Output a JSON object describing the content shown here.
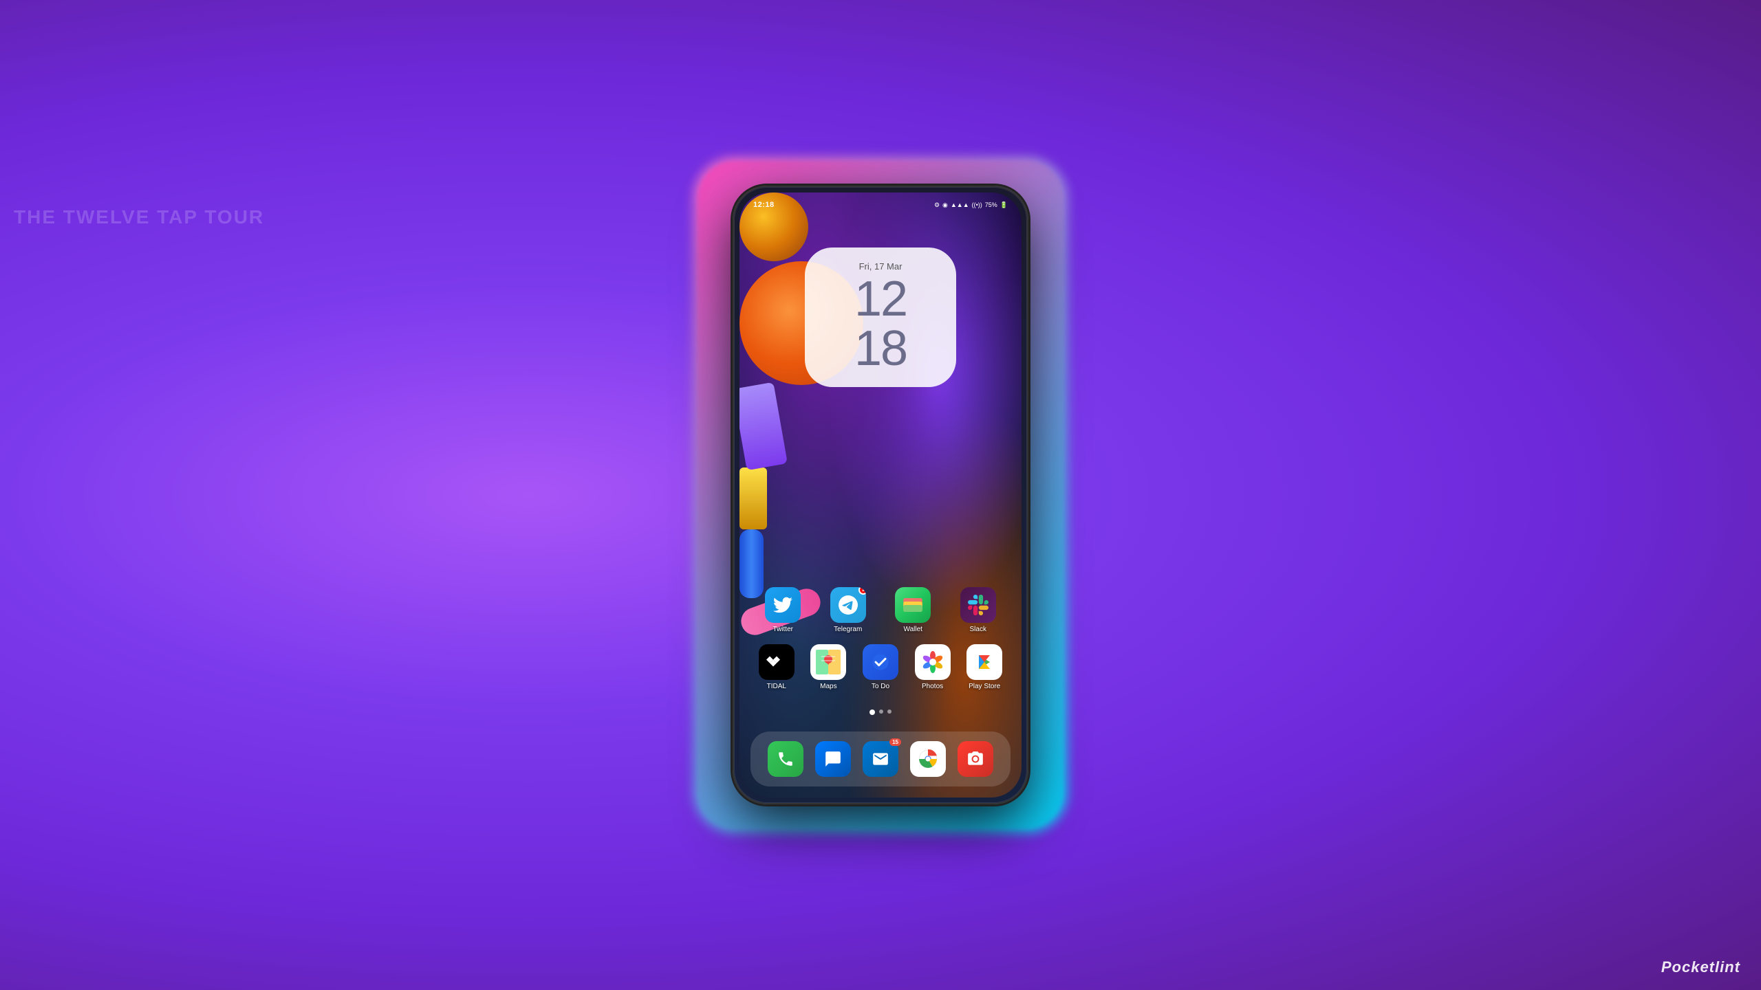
{
  "background": {
    "color_primary": "#9b2fc9",
    "color_secondary": "#7c3aed"
  },
  "phone": {
    "status_bar": {
      "time": "12:18",
      "battery": "75%",
      "settings_icon": "gear-icon",
      "location_icon": "location-icon",
      "signal_icon": "signal-icon",
      "wifi_icon": "wifi-icon"
    },
    "clock_widget": {
      "date": "Fri, 17 Mar",
      "hour": "12",
      "minute": "18"
    },
    "app_rows": [
      {
        "row": 1,
        "apps": [
          {
            "id": "twitter",
            "label": "Twitter",
            "icon_type": "twitter",
            "badge": null
          },
          {
            "id": "telegram",
            "label": "Telegram",
            "icon_type": "telegram",
            "badge": "1"
          },
          {
            "id": "wallet",
            "label": "Wallet",
            "icon_type": "wallet",
            "badge": null
          },
          {
            "id": "slack",
            "label": "Slack",
            "icon_type": "slack",
            "badge": null
          }
        ]
      },
      {
        "row": 2,
        "apps": [
          {
            "id": "tidal",
            "label": "TIDAL",
            "icon_type": "tidal",
            "badge": null
          },
          {
            "id": "maps",
            "label": "Maps",
            "icon_type": "maps",
            "badge": null
          },
          {
            "id": "todo",
            "label": "To Do",
            "icon_type": "todo",
            "badge": null
          },
          {
            "id": "photos",
            "label": "Photos",
            "icon_type": "photos",
            "badge": null
          },
          {
            "id": "playstore",
            "label": "Play Store",
            "icon_type": "playstore",
            "badge": null
          }
        ]
      }
    ],
    "page_dots": [
      "active",
      "inactive",
      "inactive"
    ],
    "dock": {
      "apps": [
        {
          "id": "phone",
          "label": "Phone",
          "icon_type": "phone-app"
        },
        {
          "id": "messages",
          "label": "Messages",
          "icon_type": "messages"
        },
        {
          "id": "outlook",
          "label": "Outlook",
          "icon_type": "outlook",
          "badge": "15"
        },
        {
          "id": "chrome",
          "label": "Chrome",
          "icon_type": "chrome"
        },
        {
          "id": "camera",
          "label": "Camera",
          "icon_type": "camera"
        }
      ]
    }
  },
  "watermark": {
    "text": "Pocketlint",
    "italic": true
  }
}
